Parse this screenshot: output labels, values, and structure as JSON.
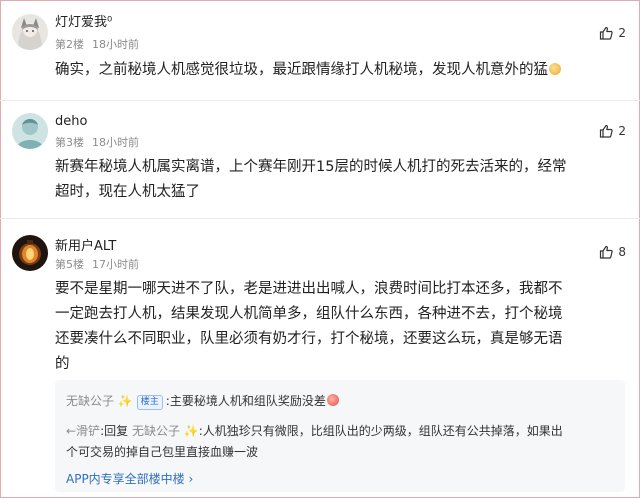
{
  "posts": [
    {
      "username": "灯灯爱我⁰",
      "floor": "第2楼",
      "time": "18小时前",
      "likes": "2",
      "content": "确实，之前秘境人机感觉很垃圾，最近跟情缘打人机秘境，发现人机意外的猛",
      "avatar": "avatar-anime-girl"
    },
    {
      "username": "deho",
      "floor": "第3楼",
      "time": "18小时前",
      "likes": "2",
      "content_lines": [
        "新赛年秘境人机属实离谱，上个赛年刚开15层的时候人机打的死去活来的，经常",
        "超时，现在人机太猛了"
      ],
      "avatar": "avatar-teal-figure"
    },
    {
      "username": "新用户ALT",
      "floor": "第5楼",
      "time": "17小时前",
      "likes": "8",
      "content_lines": [
        "要不是星期一哪天进不了队，老是进进出出喊人，浪费时间比打本还多，我都不",
        "一定跑去打人机，结果发现人机简单多，组队什么东西，各种进不去，打个秘境",
        "还要凑什么不同职业，队里必须有奶才行，打个秘境，还要这么玩，真是够无语",
        "的"
      ],
      "avatar": "avatar-lantern",
      "replies": [
        {
          "name": "无缺公子 ✨",
          "badge": "楼主",
          "text": ":主要秘境人机和组队奖励没差"
        },
        {
          "name": "←滑铲",
          "reply_word": ":回复",
          "reply_to": "无缺公子 ✨",
          "text1": ":人机独珍只有微限，比组队出的少两级，组队还有公共掉落，如果出",
          "text2": "个可交易的掉自己包里直接血赚一波"
        }
      ],
      "more_label": "APP内专享全部楼中楼 ›"
    }
  ],
  "colors": {
    "accent": "#2f6fc1",
    "muted": "#8c8c8c",
    "frame": "#e3a9b2"
  }
}
